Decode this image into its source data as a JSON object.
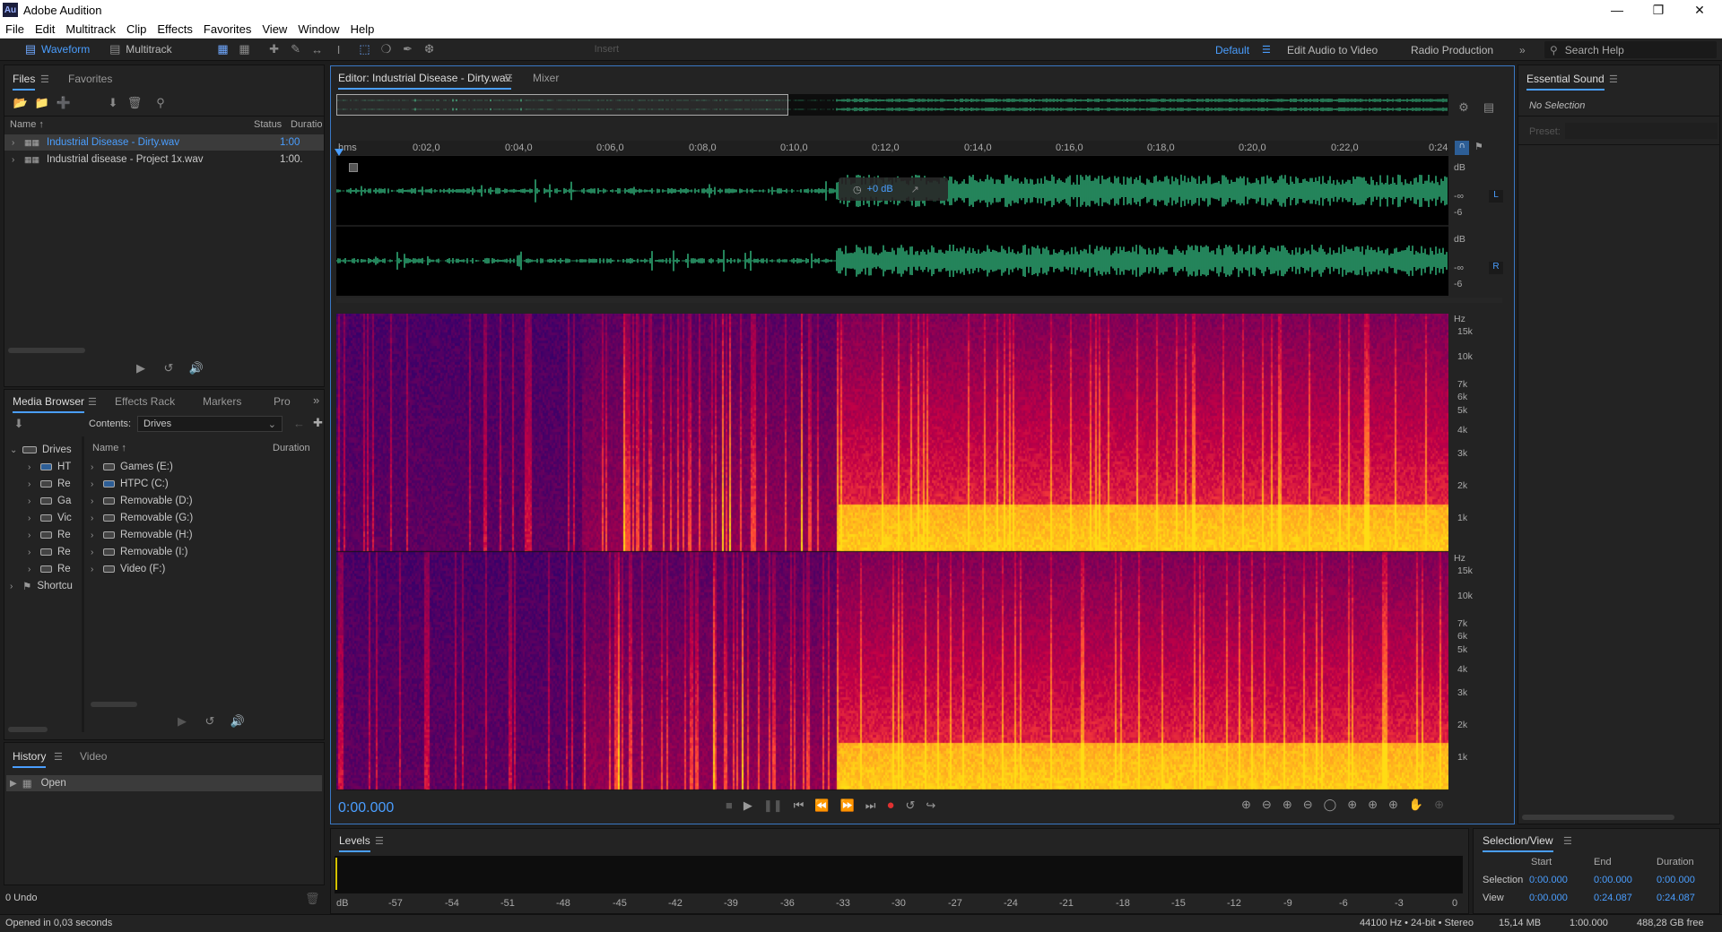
{
  "app": {
    "title": "Adobe Audition",
    "logo": "Au"
  },
  "menu": [
    "File",
    "Edit",
    "Multitrack",
    "Clip",
    "Effects",
    "Favorites",
    "View",
    "Window",
    "Help"
  ],
  "toolbar": {
    "waveform": "Waveform",
    "multitrack": "Multitrack",
    "insert": "Insert"
  },
  "workspaces": {
    "default": "Default",
    "edit_audio_video": "Edit Audio to Video",
    "radio": "Radio Production",
    "search": "Search Help"
  },
  "files_panel": {
    "tab_files": "Files",
    "tab_favorites": "Favorites",
    "col_name": "Name ↑",
    "col_status": "Status",
    "col_duration": "Duratio",
    "items": [
      {
        "name": "Industrial Disease - Dirty.wav",
        "duration": "1:00",
        "selected": true
      },
      {
        "name": "Industrial disease - Project 1x.wav",
        "duration": "1:00."
      }
    ]
  },
  "media_browser": {
    "tab_media": "Media Browser",
    "tab_effects": "Effects Rack",
    "tab_markers": "Markers",
    "tab_pro": "Pro",
    "contents_label": "Contents:",
    "contents_value": "Drives",
    "col_name": "Name ↑",
    "col_duration": "Duration",
    "tree_root": "Drives",
    "tree_items": [
      "HT",
      "Re",
      "Ga",
      "Vic",
      "Re",
      "Re",
      "Re"
    ],
    "tree_shortcuts": "Shortcu",
    "drives": [
      "Games (E:)",
      "HTPC (C:)",
      "Removable (D:)",
      "Removable (G:)",
      "Removable (H:)",
      "Removable (I:)",
      "Video (F:)"
    ]
  },
  "history": {
    "tab_history": "History",
    "tab_video": "Video",
    "item": "Open",
    "undo": "0 Undo"
  },
  "status": {
    "left": "Opened in 0,03 seconds",
    "format": "44100 Hz • 24-bit • Stereo",
    "size": "15,14 MB",
    "duration": "1:00.000",
    "free": "488,28 GB free"
  },
  "editor": {
    "tab": "Editor: Industrial Disease - Dirty.wav",
    "mixer": "Mixer",
    "hud_gain": "+0 dB",
    "time_labels": [
      "hms",
      "0:02,0",
      "0:04,0",
      "0:06,0",
      "0:08,0",
      "0:10,0",
      "0:12,0",
      "0:14,0",
      "0:16,0",
      "0:18,0",
      "0:20,0",
      "0:22,0",
      "0:24"
    ],
    "db_labels": [
      "dB",
      "-∞",
      "-6"
    ],
    "ch_left": "L",
    "ch_right": "R",
    "hz_labels": [
      "Hz",
      "15k",
      "10k",
      "7k",
      "6k",
      "5k",
      "4k",
      "3k",
      "2k",
      "1k"
    ],
    "timecode": "0:00.000"
  },
  "essential_sound": {
    "title": "Essential Sound",
    "no_selection": "No Selection",
    "preset": "Preset:"
  },
  "levels": {
    "title": "Levels",
    "scale": [
      "dB",
      "-57",
      "-54",
      "-51",
      "-48",
      "-45",
      "-42",
      "-39",
      "-36",
      "-33",
      "-30",
      "-27",
      "-24",
      "-21",
      "-18",
      "-15",
      "-12",
      "-9",
      "-6",
      "-3",
      "0"
    ]
  },
  "selection_view": {
    "title": "Selection/View",
    "col_start": "Start",
    "col_end": "End",
    "col_duration": "Duration",
    "sel_label": "Selection",
    "sel_start": "0:00.000",
    "sel_end": "0:00.000",
    "sel_dur": "0:00.000",
    "view_label": "View",
    "view_start": "0:00.000",
    "view_end": "0:24.087",
    "view_dur": "0:24.087"
  },
  "colors": {
    "accent": "#4a9eff",
    "wave": "#3ddc97",
    "record": "#e03131"
  }
}
